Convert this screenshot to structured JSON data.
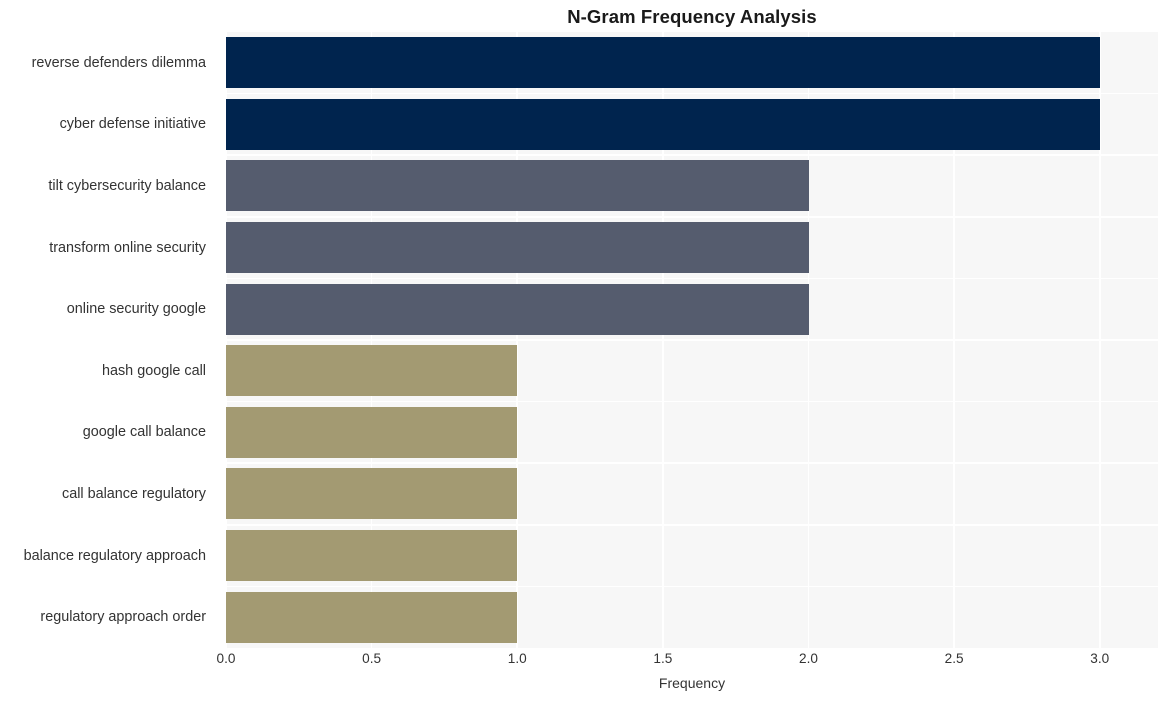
{
  "chart_data": {
    "type": "bar",
    "orientation": "horizontal",
    "title": "N-Gram Frequency Analysis",
    "xlabel": "Frequency",
    "ylabel": "",
    "xlim": [
      0.0,
      3.2
    ],
    "xticks": [
      "0.0",
      "0.5",
      "1.0",
      "1.5",
      "2.0",
      "2.5",
      "3.0"
    ],
    "xtick_values": [
      0.0,
      0.5,
      1.0,
      1.5,
      2.0,
      2.5,
      3.0
    ],
    "grid": true,
    "legend": "none",
    "categories": [
      "reverse defenders dilemma",
      "cyber defense initiative",
      "tilt cybersecurity balance",
      "transform online security",
      "online security google",
      "hash google call",
      "google call balance",
      "call balance regulatory",
      "balance regulatory approach",
      "regulatory approach order"
    ],
    "values": [
      3,
      3,
      2,
      2,
      2,
      1,
      1,
      1,
      1,
      1
    ],
    "bar_colors": [
      "#00244e",
      "#00244e",
      "#555c6e",
      "#555c6e",
      "#555c6e",
      "#a39a72",
      "#a39a72",
      "#a39a72",
      "#a39a72",
      "#a39a72"
    ]
  },
  "style": {
    "plot_background": "#f7f7f7",
    "gridline_color": "#ffffff",
    "text_color": "#333333",
    "title_color": "#1a1a1a",
    "figure_background": "#ffffff"
  }
}
